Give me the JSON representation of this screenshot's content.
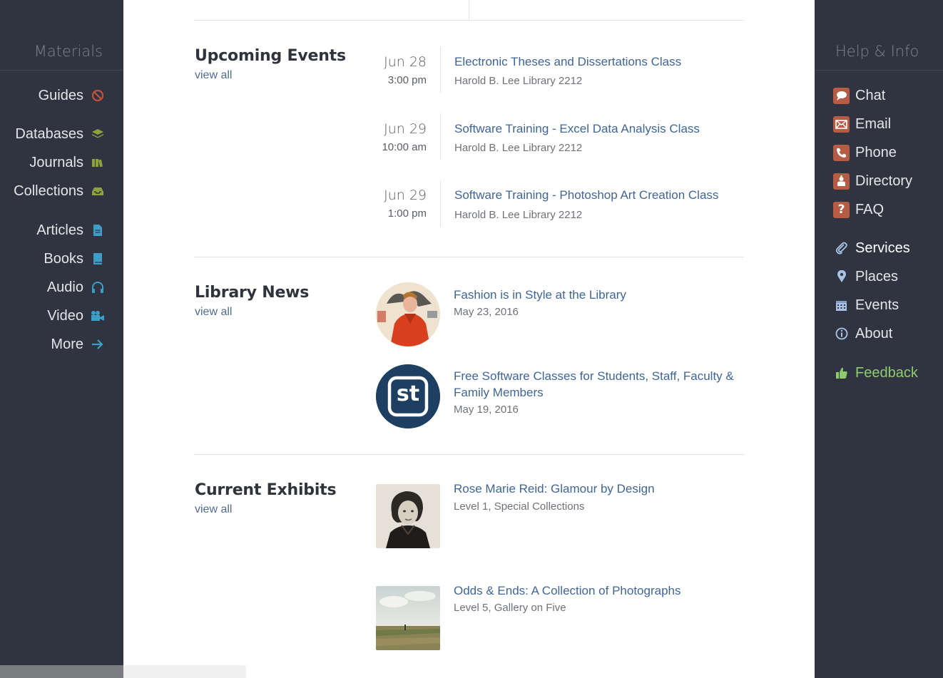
{
  "left_nav": {
    "heading": "Materials",
    "items": [
      {
        "label": "Guides",
        "icon": "no-entry-icon",
        "color": "#c7503a"
      },
      {
        "label": "Databases",
        "icon": "layers-icon",
        "color": "#8fa13c"
      },
      {
        "label": "Journals",
        "icon": "books-icon",
        "color": "#8fa13c"
      },
      {
        "label": "Collections",
        "icon": "inbox-tray-icon",
        "color": "#8fa13c"
      },
      {
        "label": "Articles",
        "icon": "document-icon",
        "color": "#3b9fc7"
      },
      {
        "label": "Books",
        "icon": "book-icon",
        "color": "#3b9fc7"
      },
      {
        "label": "Audio",
        "icon": "headphones-icon",
        "color": "#3b9fc7"
      },
      {
        "label": "Video",
        "icon": "video-camera-icon",
        "color": "#3b9fc7"
      },
      {
        "label": "More",
        "icon": "arrow-right-icon",
        "color": "#3b9fc7"
      }
    ]
  },
  "right_nav": {
    "heading": "Help & Info",
    "items": [
      {
        "label": "Chat",
        "icon": "chat-bubble-icon"
      },
      {
        "label": "Email",
        "icon": "envelope-icon"
      },
      {
        "label": "Phone",
        "icon": "phone-icon"
      },
      {
        "label": "Directory",
        "icon": "person-badge-icon"
      },
      {
        "label": "FAQ",
        "icon": "question-icon"
      },
      {
        "label": "Services",
        "icon": "paperclip-icon"
      },
      {
        "label": "Places",
        "icon": "map-pin-icon"
      },
      {
        "label": "Events",
        "icon": "calendar-icon"
      },
      {
        "label": "About",
        "icon": "info-icon"
      },
      {
        "label": "Feedback",
        "icon": "thumbs-up-icon"
      }
    ]
  },
  "events": {
    "title": "Upcoming Events",
    "view_all": "view all",
    "items": [
      {
        "day": "Jun 28",
        "time": "3:00 pm",
        "title": "Electronic Theses and Dissertations Class",
        "location": "Harold B. Lee Library 2212"
      },
      {
        "day": "Jun 29",
        "time": "10:00 am",
        "title": "Software Training - Excel Data Analysis Class",
        "location": "Harold B. Lee Library 2212"
      },
      {
        "day": "Jun 29",
        "time": "1:00 pm",
        "title": "Software Training - Photoshop Art Creation Class",
        "location": "Harold B. Lee Library 2212"
      }
    ]
  },
  "news": {
    "title": "Library News",
    "view_all": "view all",
    "items": [
      {
        "title": "Fashion is in Style at the Library",
        "date": "May 23, 2016"
      },
      {
        "title": "Free Software Classes for Students, Staff, Faculty & Family Members",
        "date": "May 19, 2016",
        "logo_text": "st"
      }
    ]
  },
  "exhibits": {
    "title": "Current Exhibits",
    "view_all": "view all",
    "items": [
      {
        "title": "Rose Marie Reid: Glamour by Design",
        "location": "Level 1, Special Collections"
      },
      {
        "title": "Odds & Ends: A Collection of Photographs",
        "location": "Level 5, Gallery on Five"
      }
    ]
  },
  "colors": {
    "sidebar_bg": "#2f3440",
    "link": "#3f6597",
    "help_icon_bg": "#b65b44",
    "feedback": "#8fcc6a"
  }
}
